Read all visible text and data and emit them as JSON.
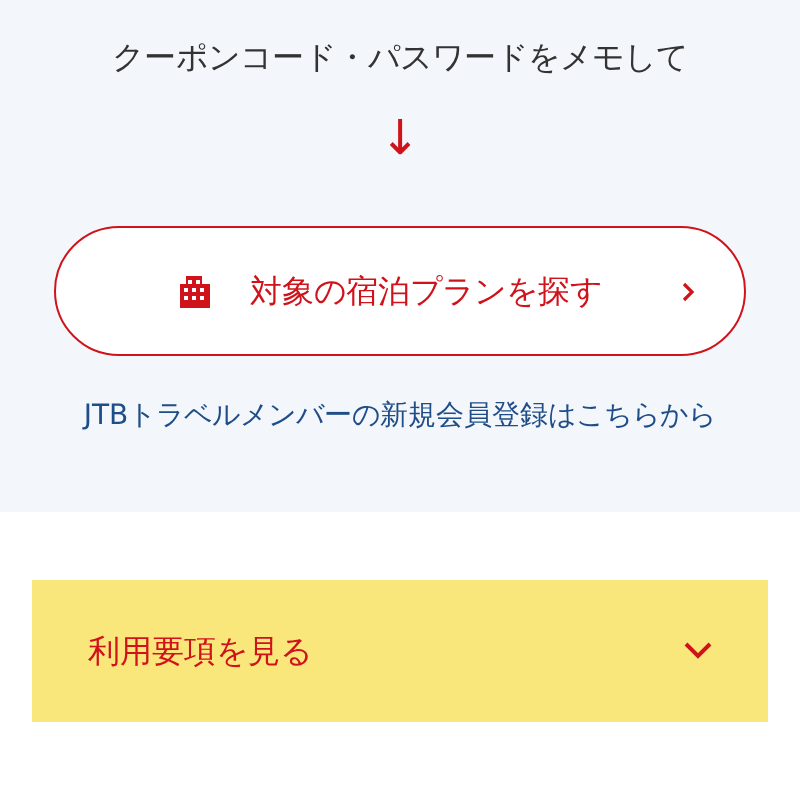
{
  "instruction": "クーポンコード・パスワードをメモして",
  "arrow": "↓",
  "search_button": {
    "label": "対象の宿泊プランを探す"
  },
  "register_link": "JTBトラベルメンバーの新規会員登録はこちらから",
  "terms_accordion": {
    "label": "利用要項を見る",
    "expanded": false
  }
}
